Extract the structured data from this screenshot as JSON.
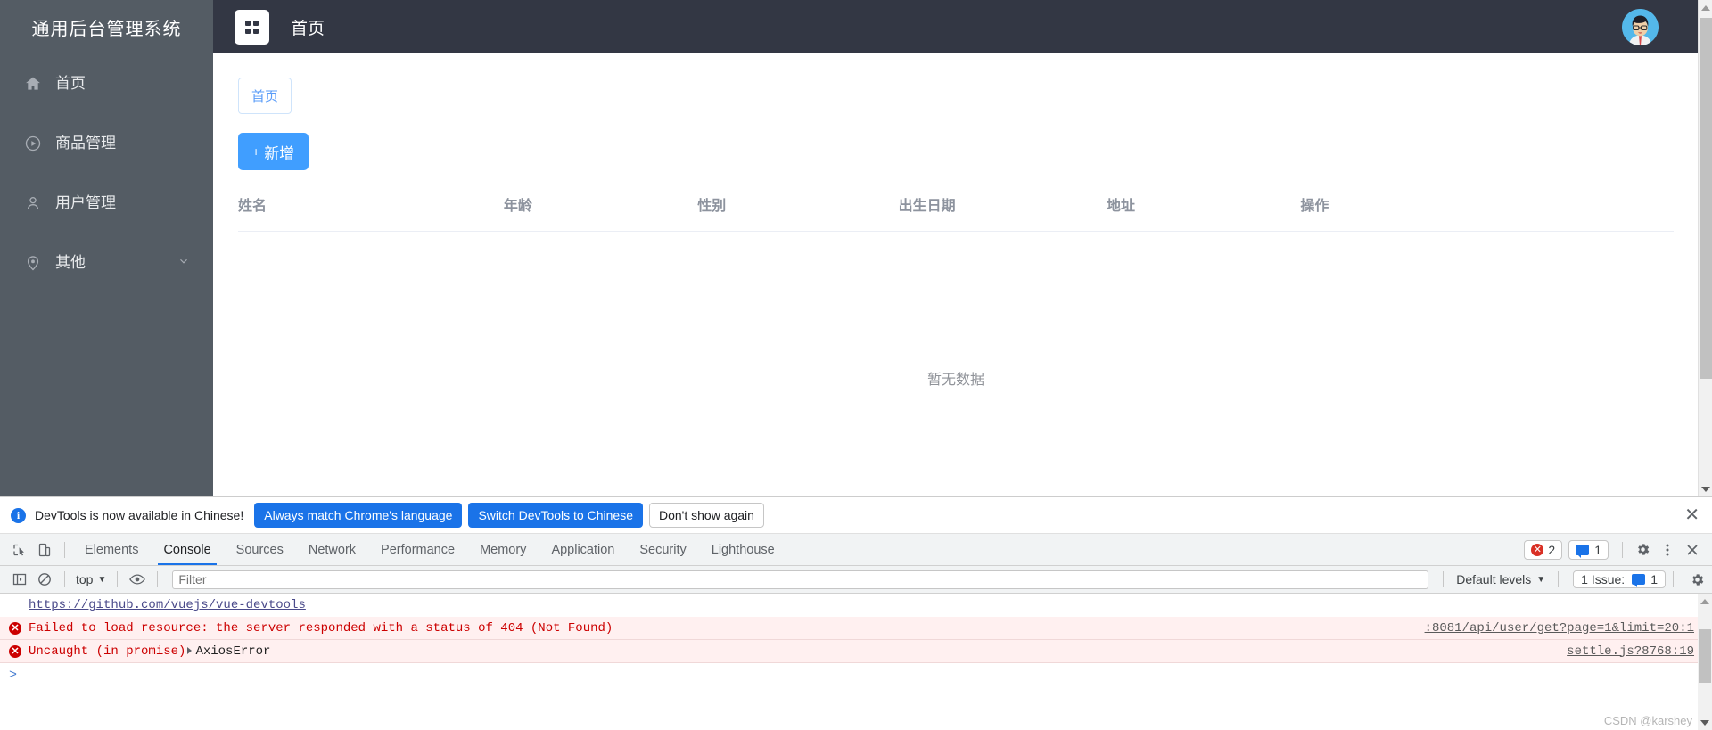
{
  "app": {
    "brand": "通用后台管理系统",
    "header_title": "首页",
    "grid_icon": "grid-icon",
    "avatar_alt": "user-avatar"
  },
  "sidebar": {
    "items": [
      {
        "label": "首页",
        "icon": "home-icon",
        "has_arrow": false
      },
      {
        "label": "商品管理",
        "icon": "play-circle-icon",
        "has_arrow": false
      },
      {
        "label": "用户管理",
        "icon": "user-icon",
        "has_arrow": false
      },
      {
        "label": "其他",
        "icon": "location-pin-icon",
        "has_arrow": true
      }
    ]
  },
  "main": {
    "breadcrumb": "首页",
    "add_button": "新增",
    "add_button_plus": "+",
    "table": {
      "headers": [
        "姓名",
        "年龄",
        "性别",
        "出生日期",
        "地址",
        "操作"
      ],
      "rows": [],
      "empty_text": "暂无数据"
    }
  },
  "devtools": {
    "infobar": {
      "icon": "info-icon",
      "message": "DevTools is now available in Chinese!",
      "buttons": [
        {
          "label": "Always match Chrome's language",
          "style": "primary"
        },
        {
          "label": "Switch DevTools to Chinese",
          "style": "primary"
        },
        {
          "label": "Don't show again",
          "style": "plain"
        }
      ],
      "close_icon": "close-icon"
    },
    "tabbar": {
      "inspect_icon": "inspect-element-icon",
      "device_icon": "device-toolbar-icon",
      "tabs": [
        {
          "label": "Elements",
          "active": false
        },
        {
          "label": "Console",
          "active": true
        },
        {
          "label": "Sources",
          "active": false
        },
        {
          "label": "Network",
          "active": false
        },
        {
          "label": "Performance",
          "active": false
        },
        {
          "label": "Memory",
          "active": false
        },
        {
          "label": "Application",
          "active": false
        },
        {
          "label": "Security",
          "active": false
        },
        {
          "label": "Lighthouse",
          "active": false
        }
      ],
      "error_count": "2",
      "warning_count": "1",
      "settings_icon": "gear-icon",
      "more_icon": "more-vertical-icon",
      "close_icon": "close-icon"
    },
    "console_toolbar": {
      "sidebar_icon": "console-sidebar-icon",
      "clear_icon": "clear-console-icon",
      "context": "top",
      "eye_icon": "live-expression-icon",
      "filter_placeholder": "Filter",
      "filter_value": "",
      "levels": "Default levels",
      "issues_label": "1 Issue:",
      "issues_count": "1",
      "gear_icon": "console-settings-icon"
    },
    "console_messages": [
      {
        "type": "link-only",
        "text": "https://github.com/vuejs/vue-devtools",
        "source": ""
      },
      {
        "type": "error",
        "icon": "error-icon",
        "text": "Failed to load resource: the server responded with a status of 404 (Not Found)",
        "source": ":8081/api/user/get?page=1&limit=20:1"
      },
      {
        "type": "error",
        "icon": "error-icon",
        "text": "Uncaught (in promise)",
        "expandable": "AxiosError",
        "source": "settle.js?8768:19"
      }
    ],
    "prompt_glyph": ">"
  },
  "watermark": "CSDN @karshey",
  "colors": {
    "sidebar_bg": "#545c64",
    "header_bg": "#333744",
    "primary_blue": "#409eff",
    "devtools_blue": "#1a73e8",
    "error_red": "#cc0000"
  }
}
